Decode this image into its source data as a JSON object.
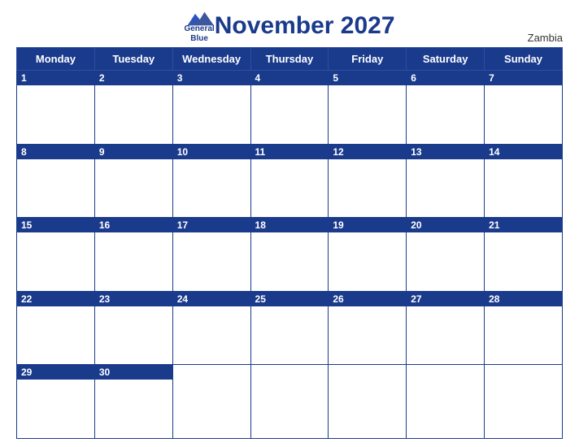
{
  "header": {
    "title": "November 2027",
    "country": "Zambia",
    "logo": {
      "line1": "General",
      "line2": "Blue"
    }
  },
  "weekdays": [
    "Monday",
    "Tuesday",
    "Wednesday",
    "Thursday",
    "Friday",
    "Saturday",
    "Sunday"
  ],
  "weeks": [
    [
      1,
      2,
      3,
      4,
      5,
      6,
      7
    ],
    [
      8,
      9,
      10,
      11,
      12,
      13,
      14
    ],
    [
      15,
      16,
      17,
      18,
      19,
      20,
      21
    ],
    [
      22,
      23,
      24,
      25,
      26,
      27,
      28
    ],
    [
      29,
      30,
      null,
      null,
      null,
      null,
      null
    ]
  ],
  "colors": {
    "header_bg": "#1a3a8c",
    "header_text": "#ffffff",
    "border": "#1a3a8c",
    "title": "#1a3a8c"
  }
}
